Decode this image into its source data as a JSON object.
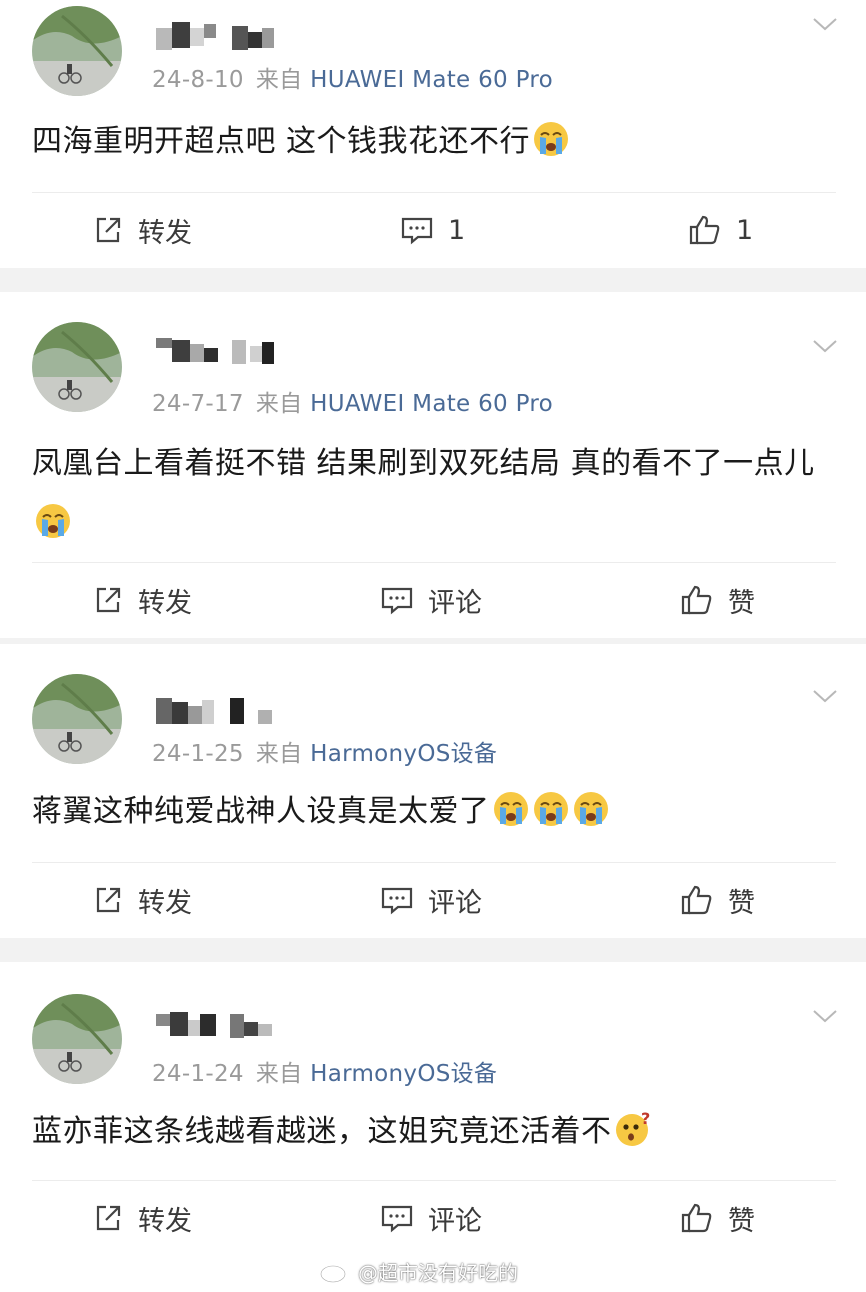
{
  "posts": [
    {
      "date": "24-8-10",
      "from_label": "来自",
      "source": "HUAWEI Mate 60 Pro",
      "content": "四海重明开超点吧 这个钱我花还不行",
      "repost_label": "转发",
      "comment_label": "1",
      "like_label": "1",
      "emoji": [
        "crying-face"
      ]
    },
    {
      "date": "24-7-17",
      "from_label": "来自",
      "source": "HUAWEI Mate 60 Pro",
      "content": "凤凰台上看着挺不错 结果刷到双死结局 真的看不了一点儿",
      "repost_label": "转发",
      "comment_label": "评论",
      "like_label": "赞",
      "emoji": [
        "crying-face"
      ]
    },
    {
      "date": "24-1-25",
      "from_label": "来自",
      "source": "HarmonyOS设备",
      "content": "蒋翼这种纯爱战神人设真是太爱了",
      "repost_label": "转发",
      "comment_label": "评论",
      "like_label": "赞",
      "emoji": [
        "crying-face",
        "crying-face",
        "crying-face"
      ]
    },
    {
      "date": "24-1-24",
      "from_label": "来自",
      "source": "HarmonyOS设备",
      "content": "蓝亦菲这条线越看越迷，这姐究竟还活着不",
      "repost_label": "转发",
      "comment_label": "评论",
      "like_label": "赞",
      "emoji": [
        "thinking-face"
      ]
    }
  ],
  "watermark": {
    "text": "@超市没有好吃的",
    "icon": "weibo-logo-icon"
  },
  "colors": {
    "background": "#f2f2f2",
    "card": "#ffffff",
    "source_link": "#4a6a96",
    "meta_gray": "#9a9a9a",
    "emoji_yellow": "#f7c843",
    "tear_blue": "#5aa9e6"
  },
  "icons": {
    "repost": "repost-icon",
    "comment": "comment-icon",
    "like": "thumbs-up-icon",
    "more": "chevron-down-icon"
  }
}
